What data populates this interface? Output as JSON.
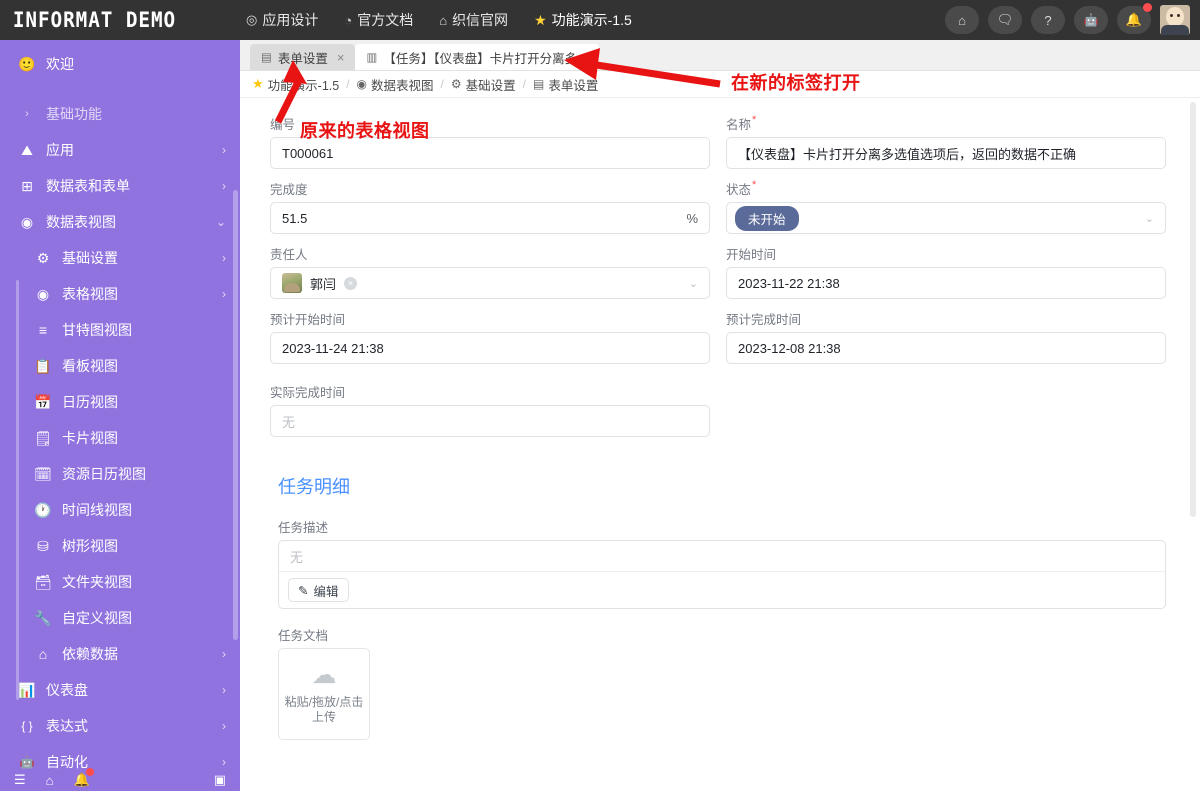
{
  "topbar": {
    "brand": "INFORMAT DEMO",
    "nav": [
      {
        "icon": "target-icon",
        "glyph": "◎",
        "label": "应用设计"
      },
      {
        "icon": "clock-icon",
        "glyph": "◔",
        "label": "官方文档"
      },
      {
        "icon": "home-icon",
        "glyph": "⌂",
        "label": "织信官网"
      },
      {
        "icon": "star-icon",
        "glyph": "★",
        "label": "功能演示-1.5"
      }
    ],
    "actions": [
      {
        "name": "home-icon",
        "glyph": "⌂"
      },
      {
        "name": "message-icon",
        "glyph": "🗨"
      },
      {
        "name": "help-icon",
        "glyph": "?"
      },
      {
        "name": "robot-icon",
        "glyph": "🤖"
      },
      {
        "name": "bell-icon",
        "glyph": "🔔",
        "badge": true
      }
    ]
  },
  "sidebar": {
    "welcome": {
      "icon": "smiley-icon",
      "glyph": "🙂",
      "label": "欢迎"
    },
    "items": [
      {
        "label": "基础功能",
        "glyph": "›",
        "icon": "chevron-right-icon",
        "arrow": "",
        "dim": true,
        "sub": false
      },
      {
        "label": "应用",
        "glyph": "⛰",
        "icon": "mountain-icon",
        "arrow": "›",
        "dim": false,
        "sub": false
      },
      {
        "label": "数据表和表单",
        "glyph": "⊞",
        "icon": "table-icon",
        "arrow": "›",
        "dim": false,
        "sub": false
      },
      {
        "label": "数据表视图",
        "glyph": "◉",
        "icon": "view-icon",
        "arrow": "⌄",
        "dim": false,
        "sub": false
      },
      {
        "label": "基础设置",
        "glyph": "⚙",
        "icon": "gear-icon",
        "arrow": "›",
        "dim": false,
        "sub": true
      },
      {
        "label": "表格视图",
        "glyph": "◉",
        "icon": "grid-view-icon",
        "arrow": "›",
        "dim": false,
        "sub": true
      },
      {
        "label": "甘特图视图",
        "glyph": "≡",
        "icon": "gantt-icon",
        "arrow": "",
        "dim": false,
        "sub": true
      },
      {
        "label": "看板视图",
        "glyph": "📋",
        "icon": "kanban-icon",
        "arrow": "",
        "dim": false,
        "sub": true
      },
      {
        "label": "日历视图",
        "glyph": "📅",
        "icon": "calendar-icon",
        "arrow": "",
        "dim": false,
        "sub": true
      },
      {
        "label": "卡片视图",
        "glyph": "🗒",
        "icon": "card-icon",
        "arrow": "",
        "dim": false,
        "sub": true
      },
      {
        "label": "资源日历视图",
        "glyph": "🗓",
        "icon": "resource-calendar-icon",
        "arrow": "",
        "dim": false,
        "sub": true
      },
      {
        "label": "时间线视图",
        "glyph": "🕐",
        "icon": "timeline-icon",
        "arrow": "",
        "dim": false,
        "sub": true
      },
      {
        "label": "树形视图",
        "glyph": "⛁",
        "icon": "tree-icon",
        "arrow": "",
        "dim": false,
        "sub": true
      },
      {
        "label": "文件夹视图",
        "glyph": "🗃",
        "icon": "folder-icon",
        "arrow": "",
        "dim": false,
        "sub": true
      },
      {
        "label": "自定义视图",
        "glyph": "🔧",
        "icon": "custom-view-icon",
        "arrow": "",
        "dim": false,
        "sub": true
      },
      {
        "label": "依赖数据",
        "glyph": "⌂",
        "icon": "dependency-icon",
        "arrow": "›",
        "dim": false,
        "sub": true
      },
      {
        "label": "仪表盘",
        "glyph": "📊",
        "icon": "dashboard-icon",
        "arrow": "›",
        "dim": false,
        "sub": false
      },
      {
        "label": "表达式",
        "glyph": "{ }",
        "icon": "expression-icon",
        "arrow": "›",
        "dim": false,
        "sub": false
      },
      {
        "label": "自动化",
        "glyph": "🤖",
        "icon": "automation-icon",
        "arrow": "›",
        "dim": false,
        "sub": false
      }
    ],
    "bottom": [
      {
        "name": "menu-icon",
        "glyph": "☰"
      },
      {
        "name": "upload-icon",
        "glyph": "⌂"
      },
      {
        "name": "bell-icon",
        "glyph": "🔔",
        "badge": true
      },
      {
        "name": "panel-toggle-icon",
        "glyph": "▣"
      }
    ]
  },
  "tabs": [
    {
      "icon": "form-icon",
      "glyph": "▤",
      "label": "表单设置",
      "close": "×",
      "state": "active-dim"
    },
    {
      "icon": "table-icon",
      "glyph": "▥",
      "label": "【任务】【仪表盘】卡片打开分离多...",
      "close": "",
      "state": "active"
    }
  ],
  "breadcrumb": [
    {
      "icon": "star-icon",
      "glyph": "★",
      "label": "功能演示-1.5"
    },
    {
      "icon": "view-icon",
      "glyph": "◉",
      "label": "数据表视图"
    },
    {
      "icon": "gear-icon",
      "glyph": "⚙",
      "label": "基础设置"
    },
    {
      "icon": "form-icon",
      "glyph": "▤",
      "label": "表单设置"
    }
  ],
  "breadcrumb_separator": "/",
  "form": {
    "left": [
      {
        "label": "编号",
        "required": false,
        "value": "T000061",
        "placeholder": "",
        "type": "text",
        "suffix": ""
      },
      {
        "label": "完成度",
        "required": false,
        "value": "51.5",
        "placeholder": "",
        "type": "text",
        "suffix": "%"
      },
      {
        "label": "责任人",
        "required": false,
        "value": "郭闫",
        "placeholder": "",
        "type": "person",
        "suffix": ""
      },
      {
        "label": "预计开始时间",
        "required": false,
        "value": "2023-11-24 21:38",
        "placeholder": "",
        "type": "text",
        "suffix": ""
      },
      {
        "label": "实际完成时间",
        "required": false,
        "value": "",
        "placeholder": "无",
        "type": "text",
        "suffix": ""
      }
    ],
    "right": [
      {
        "label": "名称",
        "required": true,
        "value": "【仪表盘】卡片打开分离多选值选项后，返回的数据不正确",
        "placeholder": "",
        "type": "text",
        "suffix": ""
      },
      {
        "label": "状态",
        "required": true,
        "value": "未开始",
        "placeholder": "",
        "type": "tag",
        "suffix": ""
      },
      {
        "label": "开始时间",
        "required": false,
        "value": "2023-11-22 21:38",
        "placeholder": "",
        "type": "text",
        "suffix": ""
      },
      {
        "label": "预计完成时间",
        "required": false,
        "value": "2023-12-08 21:38",
        "placeholder": "",
        "type": "text",
        "suffix": ""
      }
    ],
    "section_title": "任务明细",
    "description": {
      "label": "任务描述",
      "placeholder": "无",
      "edit_button": "编辑",
      "edit_icon": "pencil-icon",
      "edit_glyph": "✎"
    },
    "document": {
      "label": "任务文档",
      "upload_text_line1": "粘贴/拖放/点击",
      "upload_text_line2": "上传",
      "upload_icon": "cloud-upload-icon"
    },
    "required_mark": "*"
  },
  "annotations": [
    {
      "name": "annotation-new-tab",
      "text": "在新的标签打开"
    },
    {
      "name": "annotation-original-grid-view",
      "text": "原来的表格视图"
    }
  ],
  "colors": {
    "sidebar": "#9173e0",
    "topbar": "#333333",
    "accent_blue": "#4a90ff",
    "annotation_red": "#e81414",
    "status_tag": "#5b6b99",
    "required_red": "#ff4d4f"
  }
}
